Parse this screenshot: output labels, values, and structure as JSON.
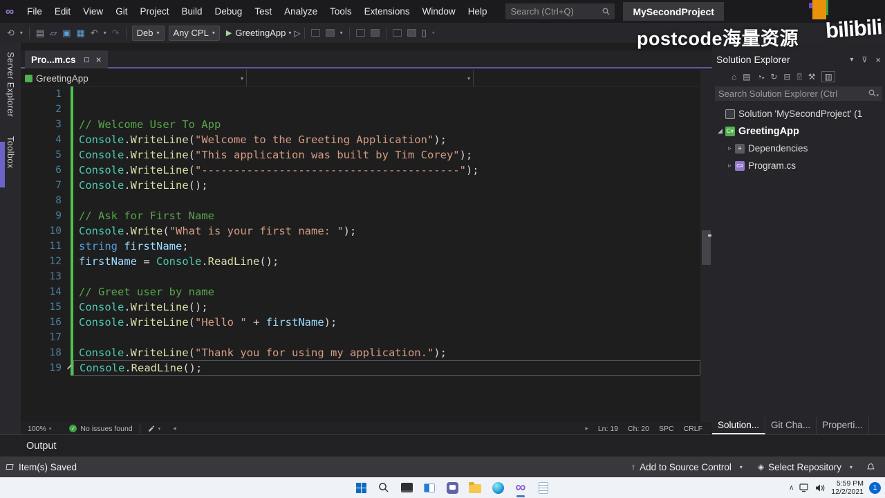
{
  "titlebar": {
    "menus": [
      "File",
      "Edit",
      "View",
      "Git",
      "Project",
      "Build",
      "Debug",
      "Test",
      "Analyze",
      "Tools",
      "Extensions",
      "Window",
      "Help"
    ],
    "search_placeholder": "Search (Ctrl+Q)",
    "project_name": "MySecondProject"
  },
  "toolbar": {
    "config_label": "Deb",
    "platform_label": "Any CPL",
    "run_label": "GreetingApp"
  },
  "watermark": {
    "text": "postcode海量资源",
    "logo": "bilibili"
  },
  "left_rail": {
    "tabs": [
      "Server Explorer",
      "Toolbox"
    ]
  },
  "editor": {
    "tab": {
      "title": "Pro...m.cs"
    },
    "breadcrumb": {
      "project": "GreetingApp"
    },
    "lines": [
      {
        "n": 1,
        "tokens": []
      },
      {
        "n": 2,
        "tokens": []
      },
      {
        "n": 3,
        "tokens": [
          [
            "com",
            "// Welcome User To App"
          ]
        ]
      },
      {
        "n": 4,
        "tokens": [
          [
            "cls",
            "Console"
          ],
          [
            "pun",
            "."
          ],
          [
            "mth",
            "WriteLine"
          ],
          [
            "pun",
            "("
          ],
          [
            "str",
            "\"Welcome to the Greeting Application\""
          ],
          [
            "pun",
            ");"
          ]
        ]
      },
      {
        "n": 5,
        "tokens": [
          [
            "cls",
            "Console"
          ],
          [
            "pun",
            "."
          ],
          [
            "mth",
            "WriteLine"
          ],
          [
            "pun",
            "("
          ],
          [
            "str",
            "\"This application was built by Tim Corey\""
          ],
          [
            "pun",
            ");"
          ]
        ]
      },
      {
        "n": 6,
        "tokens": [
          [
            "cls",
            "Console"
          ],
          [
            "pun",
            "."
          ],
          [
            "mth",
            "WriteLine"
          ],
          [
            "pun",
            "("
          ],
          [
            "str",
            "\"----------------------------------------\""
          ],
          [
            "pun",
            ");"
          ]
        ]
      },
      {
        "n": 7,
        "tokens": [
          [
            "cls",
            "Console"
          ],
          [
            "pun",
            "."
          ],
          [
            "mth",
            "WriteLine"
          ],
          [
            "pun",
            "();"
          ]
        ]
      },
      {
        "n": 8,
        "tokens": []
      },
      {
        "n": 9,
        "tokens": [
          [
            "com",
            "// Ask for First Name"
          ]
        ]
      },
      {
        "n": 10,
        "tokens": [
          [
            "cls",
            "Console"
          ],
          [
            "pun",
            "."
          ],
          [
            "mth",
            "Write"
          ],
          [
            "pun",
            "("
          ],
          [
            "str",
            "\"What is your first name: \""
          ],
          [
            "pun",
            ");"
          ]
        ]
      },
      {
        "n": 11,
        "tokens": [
          [
            "kw",
            "string"
          ],
          [
            "pun",
            " "
          ],
          [
            "var",
            "firstName"
          ],
          [
            "pun",
            ";"
          ]
        ]
      },
      {
        "n": 12,
        "tokens": [
          [
            "var",
            "firstName"
          ],
          [
            "pun",
            " = "
          ],
          [
            "cls",
            "Console"
          ],
          [
            "pun",
            "."
          ],
          [
            "mth",
            "ReadLine"
          ],
          [
            "pun",
            "();"
          ]
        ]
      },
      {
        "n": 13,
        "tokens": []
      },
      {
        "n": 14,
        "tokens": [
          [
            "com",
            "// Greet user by name"
          ]
        ]
      },
      {
        "n": 15,
        "tokens": [
          [
            "cls",
            "Console"
          ],
          [
            "pun",
            "."
          ],
          [
            "mth",
            "WriteLine"
          ],
          [
            "pun",
            "();"
          ]
        ]
      },
      {
        "n": 16,
        "tokens": [
          [
            "cls",
            "Console"
          ],
          [
            "pun",
            "."
          ],
          [
            "mth",
            "WriteLine"
          ],
          [
            "pun",
            "("
          ],
          [
            "str",
            "\"Hello \""
          ],
          [
            "pun",
            " + "
          ],
          [
            "var",
            "firstName"
          ],
          [
            "pun",
            ");"
          ]
        ]
      },
      {
        "n": 17,
        "tokens": []
      },
      {
        "n": 18,
        "tokens": [
          [
            "cls",
            "Console"
          ],
          [
            "pun",
            "."
          ],
          [
            "mth",
            "WriteLine"
          ],
          [
            "pun",
            "("
          ],
          [
            "str",
            "\"Thank you for using my application.\""
          ],
          [
            "pun",
            ");"
          ]
        ]
      },
      {
        "n": 19,
        "current": true,
        "tokens": [
          [
            "cls",
            "Console"
          ],
          [
            "pun",
            "."
          ],
          [
            "mth",
            "ReadLine"
          ],
          [
            "pun",
            "();"
          ]
        ]
      }
    ],
    "status": {
      "zoom": "100%",
      "issues": "No issues found",
      "ln": "Ln: 19",
      "ch": "Ch: 20",
      "spc": "SPC",
      "eol": "CRLF"
    }
  },
  "output_panel": {
    "title": "Output"
  },
  "solution_explorer": {
    "title": "Solution Explorer",
    "search_placeholder": "Search Solution Explorer (Ctrl",
    "items": [
      {
        "indent": 0,
        "arrow": "",
        "icon": "solution-icon",
        "icon_class": "ti-solution",
        "glyph": "",
        "label": "Solution 'MySecondProject' (1",
        "bold": false
      },
      {
        "indent": 0,
        "arrow": "expanded",
        "icon": "csharp-project-icon",
        "icon_class": "ti-csproj",
        "glyph": "C#",
        "label": "GreetingApp",
        "bold": true
      },
      {
        "indent": 1,
        "arrow": "collapsed",
        "icon": "dependencies-icon",
        "icon_class": "ti-deps",
        "glyph": "≡",
        "label": "Dependencies",
        "bold": false
      },
      {
        "indent": 1,
        "arrow": "collapsed",
        "icon": "csharp-file-icon",
        "icon_class": "ti-cs",
        "glyph": "C#",
        "label": "Program.cs",
        "bold": false
      }
    ],
    "bottom_tabs": [
      {
        "label": "Solution...",
        "active": true
      },
      {
        "label": "Git Cha...",
        "active": false
      },
      {
        "label": "Properti...",
        "active": false
      }
    ]
  },
  "statusbar": {
    "saved_label": "Item(s) Saved",
    "add_source_label": "Add to Source Control",
    "select_repo_label": "Select Repository"
  },
  "taskbar": {
    "time": "5:59 PM",
    "date": "12/2/2021",
    "badge": "1"
  },
  "colors": {
    "accent_purple": "#5b5b9d",
    "change_bar_green": "#4ec04e",
    "issues_check_green": "#3fa33f",
    "comment_green": "#57a64a",
    "class_teal": "#4ec9b0",
    "string_salmon": "#d69d85",
    "keyword_blue": "#569cd6",
    "taskbar_badge_blue": "#0b66d0"
  }
}
